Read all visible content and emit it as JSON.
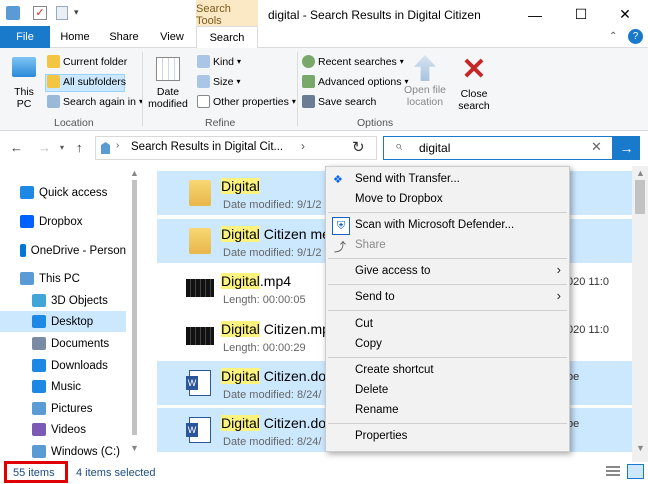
{
  "window": {
    "title": "digital - Search Results in Digital Citizen",
    "contextual_tab": "Search Tools",
    "controls": [
      "—",
      "☐",
      "✕"
    ]
  },
  "tabs": [
    "File",
    "Home",
    "Share",
    "View",
    "Search"
  ],
  "ribbon": {
    "this_pc": "This PC",
    "current_folder": "Current folder",
    "all_subfolders": "All subfolders",
    "search_again_in": "Search again in",
    "location_group": "Location",
    "date_modified": "Date modified",
    "kind": "Kind",
    "size": "Size",
    "other_properties": "Other properties",
    "refine_group": "Refine",
    "recent_searches": "Recent searches",
    "advanced_options": "Advanced options",
    "save_search": "Save search",
    "open_file_location": "Open file location",
    "options_group": "Options",
    "close_search": "Close search"
  },
  "address": {
    "path": "Search Results in Digital Cit...",
    "search_value": "digital"
  },
  "nav": [
    {
      "label": "Quick access",
      "icon": "star-icon",
      "color": "#1e88e5"
    },
    {
      "label": "Dropbox",
      "icon": "dropbox-icon",
      "color": "#0061fe"
    },
    {
      "label": "OneDrive - Person",
      "icon": "cloud-icon",
      "color": "#0078d4"
    },
    {
      "label": "This PC",
      "icon": "computer-icon",
      "color": "#5b9bd5"
    },
    {
      "label": "3D Objects",
      "icon": "cube-icon",
      "color": "#42a5d8"
    },
    {
      "label": "Desktop",
      "icon": "desktop-icon",
      "color": "#1e88e5"
    },
    {
      "label": "Documents",
      "icon": "document-icon",
      "color": "#7a8ca5"
    },
    {
      "label": "Downloads",
      "icon": "download-icon",
      "color": "#1e88e5"
    },
    {
      "label": "Music",
      "icon": "music-icon",
      "color": "#1e88e5"
    },
    {
      "label": "Pictures",
      "icon": "picture-icon",
      "color": "#5b9bd5"
    },
    {
      "label": "Videos",
      "icon": "video-icon",
      "color": "#7a5ab5"
    },
    {
      "label": "Windows (C:)",
      "icon": "drive-icon",
      "color": "#5b9bd5"
    }
  ],
  "files": [
    {
      "hl": "Digital",
      "rest": "",
      "meta": "Date modified: 9/1/2",
      "right": "",
      "selected": true,
      "icon": "folder-icon"
    },
    {
      "hl": "Digital",
      "rest": " Citizen me",
      "meta": "Date modified: 9/1/2",
      "right": "",
      "selected": true,
      "icon": "folder-icon"
    },
    {
      "hl": "Digital",
      "rest": ".mp4",
      "meta": "Length: 00:00:05",
      "right": "020 11:0",
      "selected": false,
      "icon": "video-file-icon"
    },
    {
      "hl": "Digital",
      "rest": " Citizen.mp",
      "meta": "Length: 00:00:29",
      "right": "020 11:0",
      "selected": false,
      "icon": "video-file-icon"
    },
    {
      "hl": "Digital",
      "rest": " Citizen.doc",
      "meta": "Date modified: 8/24/",
      "right": "oe",
      "selected": true,
      "icon": "word-icon"
    },
    {
      "hl": "Digital",
      "rest": " Citizen.doc",
      "meta": "Date modified: 8/24/",
      "right": "oe",
      "selected": true,
      "icon": "word-icon"
    }
  ],
  "context_menu": [
    "Send with Transfer...",
    "Move to Dropbox",
    "Scan with Microsoft Defender...",
    "Share",
    "Give access to",
    "Send to",
    "Cut",
    "Copy",
    "Create shortcut",
    "Delete",
    "Rename",
    "Properties"
  ],
  "status": {
    "items": "55 items",
    "selected": "4 items selected"
  },
  "colors": {
    "accent": "#1979ca",
    "selection": "#cce8ff",
    "highlight": "#fbf37d",
    "annotation": "#e00000"
  }
}
